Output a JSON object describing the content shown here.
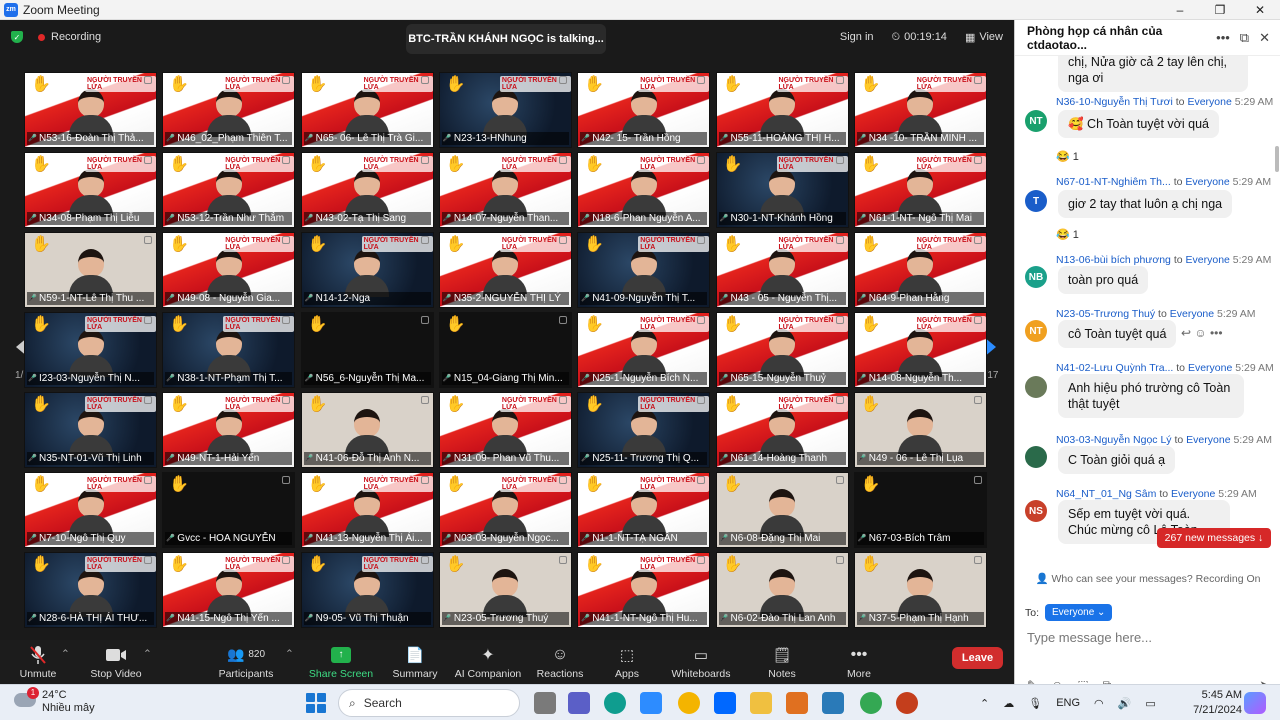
{
  "window": {
    "title": "Zoom Meeting",
    "app_icon": "zm",
    "min": "–",
    "max": "❐",
    "close": "✕"
  },
  "topbar": {
    "recording": "Recording",
    "talking": "BTC-TRẦN KHÁNH NGỌC is talking...",
    "sign_in": "Sign in",
    "timer": "00:19:14",
    "view": "View"
  },
  "pagination": {
    "left": "1/17",
    "right": "1/17"
  },
  "tiles": [
    {
      "name": "N53-16-Đoàn Thị Thả...",
      "bg": "red"
    },
    {
      "name": "N46_02_Phạm Thiên T...",
      "bg": "red"
    },
    {
      "name": "N65- 06- Lê Thị Trà Gi...",
      "bg": "red"
    },
    {
      "name": "N23-13-HNhung",
      "bg": "dark"
    },
    {
      "name": "N42- 15- Trần Hồng",
      "bg": "red"
    },
    {
      "name": "N55-11-HOÀNG THỊ H...",
      "bg": "red"
    },
    {
      "name": "N34 -10- TRẦN MINH ...",
      "bg": "red"
    },
    {
      "name": "N34-08-Phạm Thị Liễu",
      "bg": "red"
    },
    {
      "name": "N53-12-Trần Như Thắm",
      "bg": "red"
    },
    {
      "name": "N43-02-Tạ Thị Sang",
      "bg": "red"
    },
    {
      "name": "N14-07-Nguyễn Than...",
      "bg": "red"
    },
    {
      "name": "N18-6-Phan Nguyễn A...",
      "bg": "red"
    },
    {
      "name": "N30-1-NT-Khánh Hồng",
      "bg": "dark"
    },
    {
      "name": "N61-1-NT- Ngô Thị Mai",
      "bg": "red"
    },
    {
      "name": "N59-1-NT-Lê Thị Thu ...",
      "bg": "plain"
    },
    {
      "name": "N49-08 - Nguyễn Gia...",
      "bg": "red"
    },
    {
      "name": "N14-12-Nga",
      "bg": "dark"
    },
    {
      "name": "N35-2-NGUYỄN THỊ LÝ",
      "bg": "red"
    },
    {
      "name": "N41-09-Nguyễn Thị T...",
      "bg": "dark"
    },
    {
      "name": "N43 - 05 - Nguyễn Thị...",
      "bg": "red"
    },
    {
      "name": "N64-9-Phan Hằng",
      "bg": "red"
    },
    {
      "name": "I23-03-Nguyễn Thị N...",
      "bg": "dark"
    },
    {
      "name": "N38-1-NT-Phạm Thị T...",
      "bg": "dark"
    },
    {
      "name": "N56_6-Nguyễn Thị Ma...",
      "bg": "black"
    },
    {
      "name": "N15_04-Giang Thị Min...",
      "bg": "black"
    },
    {
      "name": "N25-1-Nguyễn Bích N...",
      "bg": "red"
    },
    {
      "name": "N65-15-Nguyễn Thuỷ",
      "bg": "red"
    },
    {
      "name": "N14-08-Nguyễn Th...",
      "bg": "red"
    },
    {
      "name": "N35-NT-01-Vũ Thị Linh",
      "bg": "dark"
    },
    {
      "name": "N49-NT-1-Hải Yến",
      "bg": "red"
    },
    {
      "name": "N41-06-Đỗ Thị Anh N...",
      "bg": "plain"
    },
    {
      "name": "N31-09- Phan Vũ Thu...",
      "bg": "red"
    },
    {
      "name": "N25-11- Trương Thị Q...",
      "bg": "dark"
    },
    {
      "name": "N61-14-Hoàng Thanh",
      "bg": "red"
    },
    {
      "name": "N49 - 06 - Lê Thị Lụa",
      "bg": "plain"
    },
    {
      "name": "N7-10-Ngô Thị Quy",
      "bg": "red"
    },
    {
      "name": "Gvcc - HOA NGUYỄN",
      "bg": "black"
    },
    {
      "name": "N41-13-Nguyễn Thị Ái...",
      "bg": "red"
    },
    {
      "name": "N03-03-Nguyễn Ngọc...",
      "bg": "red"
    },
    {
      "name": "N1-1-NT-TẠ NGÂN",
      "bg": "red"
    },
    {
      "name": "N6-08-Đặng Thị Mai",
      "bg": "plain"
    },
    {
      "name": "N67-03-Bích Trâm",
      "bg": "black"
    },
    {
      "name": "N28-6-HÀ THỊ ÁI THƯ...",
      "bg": "dark"
    },
    {
      "name": "N41-15-Ngô Thị Yến ...",
      "bg": "red"
    },
    {
      "name": "N9-05- Vũ Thị Thuận",
      "bg": "dark"
    },
    {
      "name": "N23-05-Trương Thuý",
      "bg": "plain"
    },
    {
      "name": "N41-1-NT-Ngô Thị Hu...",
      "bg": "red"
    },
    {
      "name": "N6-02-Đào Thị Lan Anh",
      "bg": "plain"
    },
    {
      "name": "N37-5-Phạm Thị Hạnh",
      "bg": "plain"
    }
  ],
  "tile_logo_text": "NGƯỜI TRUYỀN LỬA",
  "toolbar": {
    "unmute": "Unmute",
    "stop_video": "Stop Video",
    "participants": "Participants",
    "participant_count": "820",
    "share_screen": "Share Screen",
    "summary": "Summary",
    "ai_companion": "AI Companion",
    "reactions": "Reactions",
    "apps": "Apps",
    "whiteboards": "Whiteboards",
    "notes": "Notes",
    "more": "More",
    "leave": "Leave"
  },
  "chat": {
    "title": "Phòng họp cá nhân của ctdaotao...",
    "messages": [
      {
        "text": "chị, Nửa giờ cả 2 tay lên chị, nga ơi"
      },
      {
        "sender": "N36-10-Nguyễn Thị Tươi",
        "to": "to",
        "target": "Everyone",
        "time": "5:29 AM",
        "avatar": "NT",
        "avatar_color": "#1aa06d",
        "text": "🥰 Ch Toàn tuyệt vời quá",
        "reaction": "😂 1"
      },
      {
        "sender": "N67-01-NT-Nghiêm Th...",
        "to": "to",
        "target": "Everyone",
        "time": "5:29 AM",
        "avatar": "T",
        "avatar_color": "#1a5dc9",
        "text": "giơ 2 tay that luôn ạ chị nga",
        "reaction": "😂 1"
      },
      {
        "sender": "N13-06-bùi bích phương",
        "to": "to",
        "target": "Everyone",
        "time": "5:29 AM",
        "avatar": "NB",
        "avatar_color": "#1aa08a",
        "text": "toàn pro quá"
      },
      {
        "sender": "N23-05-Trương Thuý",
        "to": "to",
        "target": "Everyone",
        "time": "5:29 AM",
        "avatar": "NT",
        "avatar_color": "#f0a020",
        "text": "cô Toàn tuyệt quá"
      },
      {
        "sender": "N41-02-Lưu Quỳnh Tra...",
        "to": "to",
        "target": "Everyone",
        "time": "5:29 AM",
        "avatar": "",
        "avatar_color": "#6a7a5a",
        "text": "Anh hiệu phó trường cô Toàn thật tuyệt"
      },
      {
        "sender": "N03-03-Nguyễn Ngọc Lý",
        "to": "to",
        "target": "Everyone",
        "time": "5:29 AM",
        "avatar": "",
        "avatar_color": "#2a6a4a",
        "text": "C Toàn giỏi quá ạ"
      },
      {
        "sender": "N64_NT_01_Ng Sâm",
        "to": "to",
        "target": "Everyone",
        "time": "5:29 AM",
        "avatar": "NS",
        "avatar_color": "#c8402a",
        "text": "Sếp em tuyệt vời quá. Chúc mừng cô Lê Toàn"
      }
    ],
    "new_messages": "267 new messages ↓",
    "note": "👤 Who can see your messages? Recording On",
    "to_label": "To:",
    "to_value": "Everyone ⌄",
    "placeholder": "Type message here..."
  },
  "taskbar": {
    "temperature": "24°C",
    "weather": "Nhiều mây",
    "weather_badge": "1",
    "search": "Search",
    "lang": "ENG",
    "time": "5:45 AM",
    "date": "7/21/2024"
  }
}
